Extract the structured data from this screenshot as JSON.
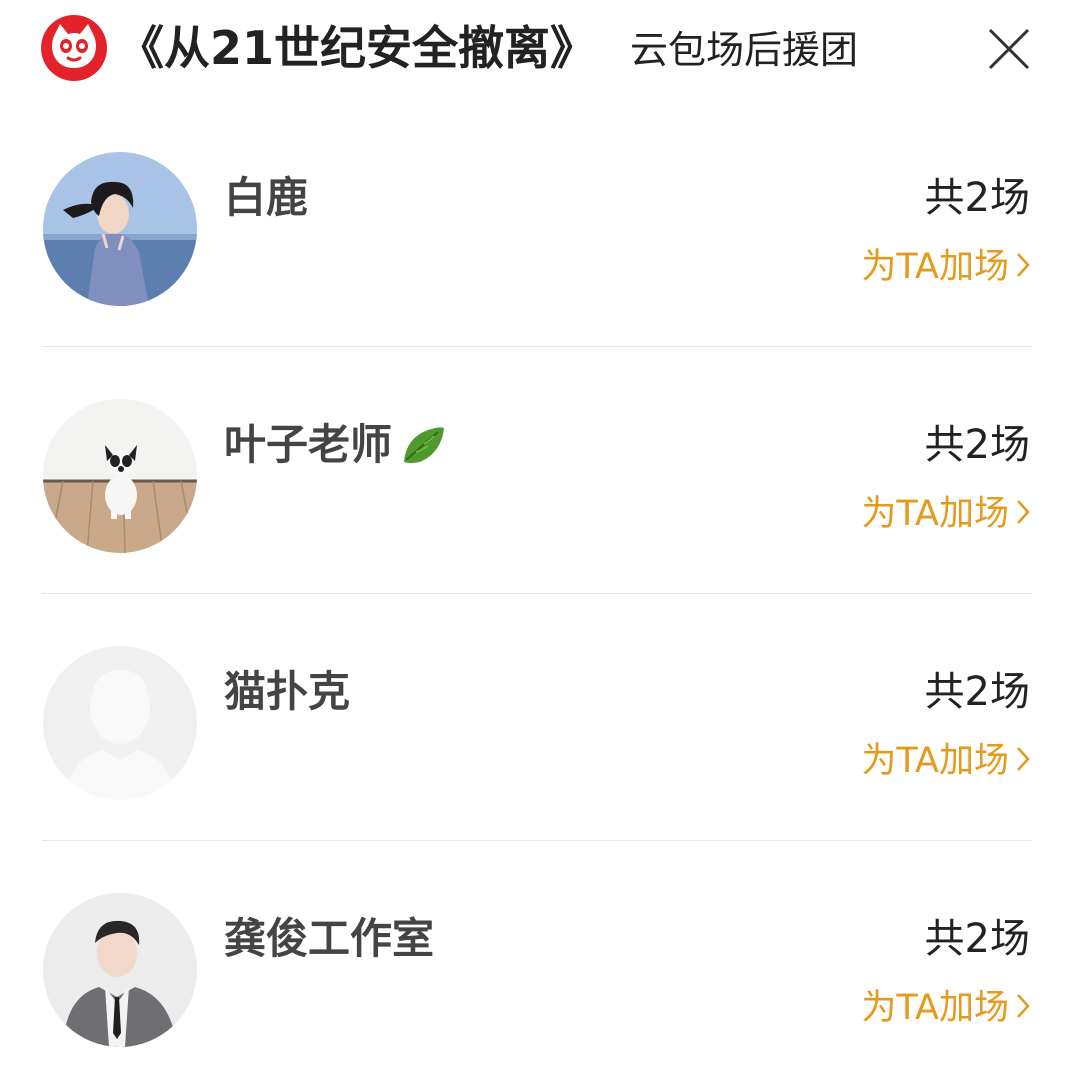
{
  "header": {
    "title": "《从21世纪安全撤离》",
    "subtitle": "云包场后援团",
    "close_icon": "close-icon",
    "logo_icon": "cat-logo-icon",
    "brand_color": "#e32229"
  },
  "rows": [
    {
      "name": "白鹿",
      "count": "共2场",
      "action": "为TA加场",
      "avatar": "photo-woman-seaside"
    },
    {
      "name": "叶子老师",
      "count": "共2场",
      "action": "为TA加场",
      "avatar": "photo-dog",
      "badge": "leaf-icon"
    },
    {
      "name": "猫扑克",
      "count": "共2场",
      "action": "为TA加场",
      "avatar": "default-silhouette"
    },
    {
      "name": "龚俊工作室",
      "count": "共2场",
      "action": "为TA加场",
      "avatar": "photo-man-suit"
    }
  ],
  "colors": {
    "accent": "#e59a1c",
    "divider": "#e8e8e8"
  }
}
